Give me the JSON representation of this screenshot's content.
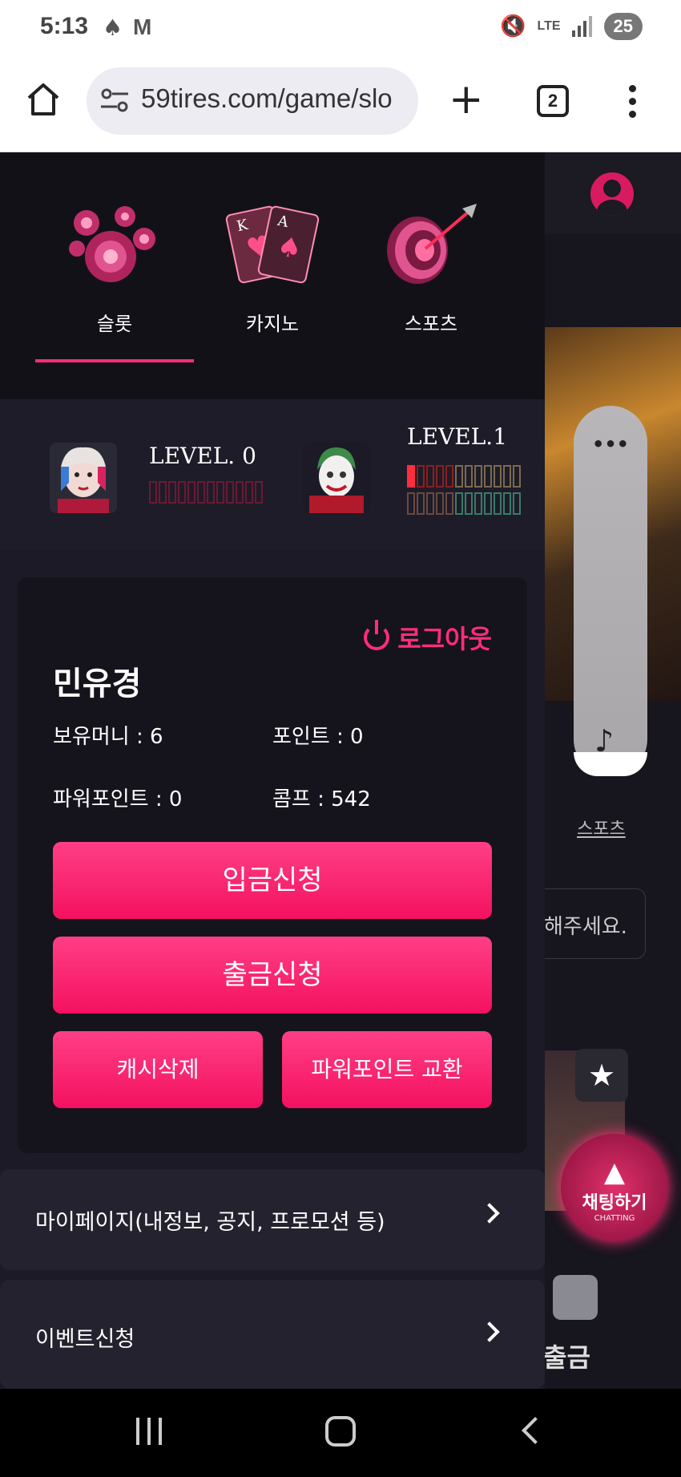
{
  "status_bar": {
    "time": "5:13",
    "network": "LTE",
    "battery": "25"
  },
  "browser": {
    "url": "59tires.com/game/slo",
    "tab_count": "2"
  },
  "categories": [
    {
      "label": "슬롯",
      "icon": "slot-chips-icon",
      "active": true
    },
    {
      "label": "카지노",
      "icon": "playing-cards-icon",
      "active": false
    },
    {
      "label": "스포츠",
      "icon": "dart-target-icon",
      "active": false
    }
  ],
  "levels": {
    "current": {
      "title": "LEVEL. 0",
      "filled": 0,
      "total": 12
    },
    "next": {
      "title": "LEVEL.1",
      "filled": 1,
      "total": 12
    }
  },
  "account": {
    "logout_label": "로그아웃",
    "username": "민유경",
    "money": "보유머니 : 6",
    "points": "포인트 : 0",
    "power_points": "파워포인트 : 0",
    "comp": "콤프 : 542"
  },
  "buttons": {
    "deposit": "입금신청",
    "withdraw": "출금신청",
    "cash_delete": "캐시삭제",
    "power_exchange": "파워포인트 교환"
  },
  "menu": [
    {
      "label": "마이페이지(내정보, 공지, 프로모션 등)"
    },
    {
      "label": "이벤트신청"
    }
  ],
  "background_page": {
    "sports_link": "스포츠",
    "input_fragment": "해주세요.",
    "chat_label": "채팅하기",
    "chat_sub": "CHATTING",
    "withdraw_label": "출금"
  },
  "colors": {
    "accent": "#ff2d7a",
    "button": "#f4115f",
    "drawer_bg": "#1c1a26"
  }
}
